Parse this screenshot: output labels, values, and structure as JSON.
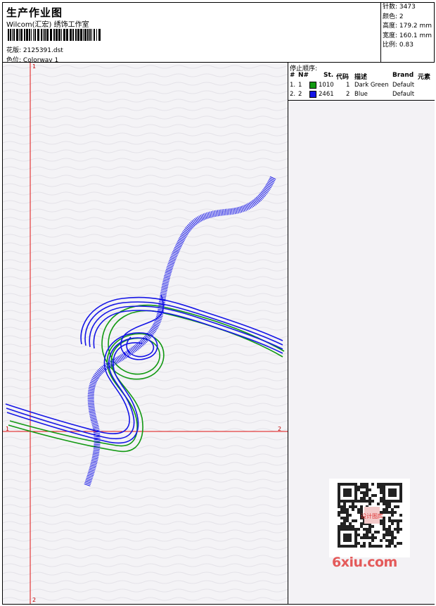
{
  "header": {
    "title": "生产作业图",
    "company": "Wilcom(汇宏)  绣饰工作室",
    "design_label": "花版:",
    "design_value": "2125391.dst",
    "colorway_label": "色位:",
    "colorway_value": "Colorway 1"
  },
  "stats": {
    "stitches": "针数: 3473",
    "colors": "颜色: 2",
    "height": "高度: 179.2 mm",
    "width": "宽度: 160.1 mm",
    "scale": "比例: 0.83"
  },
  "stop_sequence": {
    "title": "停止顺序:",
    "headers": {
      "hash": "#",
      "needle": "N#",
      "stitches": "St.",
      "code": "代码",
      "desc": "描述",
      "brand": "Brand",
      "element": "元素"
    },
    "rows": [
      {
        "index": "1.",
        "needle": "1",
        "stitches": "1010",
        "code": "1",
        "desc": "Dark Green",
        "brand": "Default",
        "color": "#119911"
      },
      {
        "index": "2.",
        "needle": "2",
        "stitches": "2461",
        "code": "2",
        "desc": "Blue",
        "brand": "Default",
        "color": "#1515e6"
      }
    ]
  },
  "axes": {
    "v_top": "1",
    "v_bottom": "2",
    "h_left": "1",
    "h_right": "2"
  },
  "watermark": "6xiu.com",
  "qr_stamp_text": "设计图库"
}
